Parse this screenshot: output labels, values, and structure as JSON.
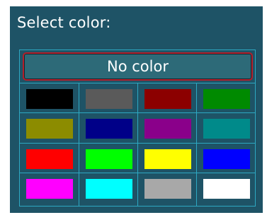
{
  "title": "Select color:",
  "no_color_label": "No color",
  "selected": "no-color",
  "colors": {
    "panel_bg": "#1e5366",
    "grid_line": "#2ea8c2",
    "selection_border": "#b31f2b"
  },
  "swatches": [
    {
      "name": "black",
      "color": "#000000"
    },
    {
      "name": "gray",
      "color": "#5a5a5a"
    },
    {
      "name": "dark-red",
      "color": "#8c0000"
    },
    {
      "name": "green",
      "color": "#008a00"
    },
    {
      "name": "olive",
      "color": "#8c8c00"
    },
    {
      "name": "navy",
      "color": "#000088"
    },
    {
      "name": "purple",
      "color": "#8a008a"
    },
    {
      "name": "teal",
      "color": "#008a8a"
    },
    {
      "name": "red",
      "color": "#ff0000"
    },
    {
      "name": "lime",
      "color": "#00ff00"
    },
    {
      "name": "yellow",
      "color": "#ffff00"
    },
    {
      "name": "blue",
      "color": "#0000ff"
    },
    {
      "name": "magenta",
      "color": "#ff00ff"
    },
    {
      "name": "cyan",
      "color": "#00ffff"
    },
    {
      "name": "silver",
      "color": "#a8a8a8"
    },
    {
      "name": "white",
      "color": "#ffffff"
    }
  ]
}
